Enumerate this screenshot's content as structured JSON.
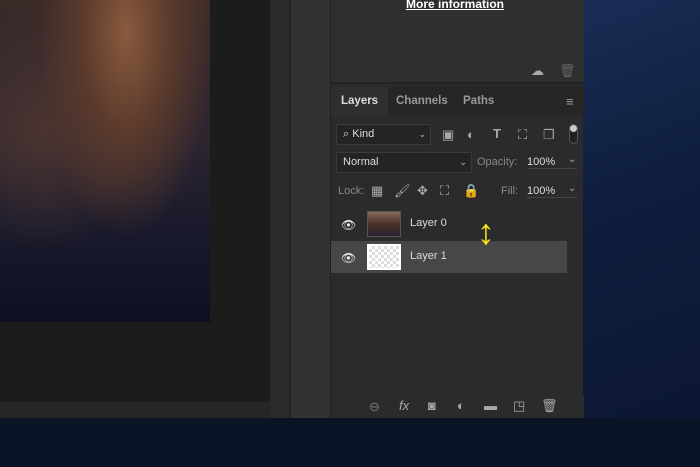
{
  "info": {
    "more_information": "More information"
  },
  "tabs": [
    {
      "label": "Layers"
    },
    {
      "label": "Channels"
    },
    {
      "label": "Paths"
    }
  ],
  "filter": {
    "kind": "Kind"
  },
  "blend": {
    "mode": "Normal",
    "opacity_label": "Opacity:",
    "opacity": "100%"
  },
  "lock": {
    "label": "Lock:",
    "fill_label": "Fill:",
    "fill": "100%"
  },
  "layers": [
    {
      "name": "Layer 0",
      "selected": false
    },
    {
      "name": "Layer 1",
      "selected": true
    }
  ],
  "colors": {
    "accent_arrow": "#f7e21a",
    "selected_row": "#474747"
  }
}
